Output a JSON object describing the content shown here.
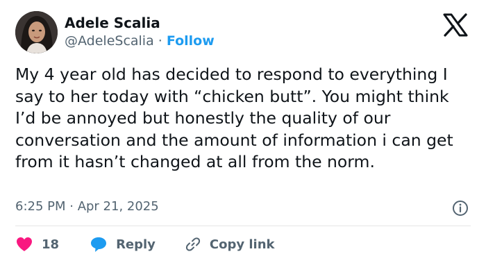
{
  "author": {
    "name": "Adele Scalia",
    "handle": "@AdeleScalia",
    "separator": "·",
    "follow_label": "Follow"
  },
  "tweet": {
    "text": "My 4 year old has decided to respond to everything I say to her today with “chicken butt”. You might think I’d be annoyed but honestly the quality of our conversation and the amount of information i can get from it hasn’t changed at all from the norm.",
    "timestamp": "6:25 PM · Apr 21, 2025"
  },
  "actions": {
    "like_count": "18",
    "reply_label": "Reply",
    "copy_label": "Copy link"
  },
  "colors": {
    "accent": "#1d9bf0",
    "like": "#f91880",
    "text": "#0f1419",
    "muted": "#536471"
  },
  "icons": [
    "x-logo-icon",
    "info-icon",
    "heart-icon",
    "reply-bubble-icon",
    "link-icon"
  ]
}
